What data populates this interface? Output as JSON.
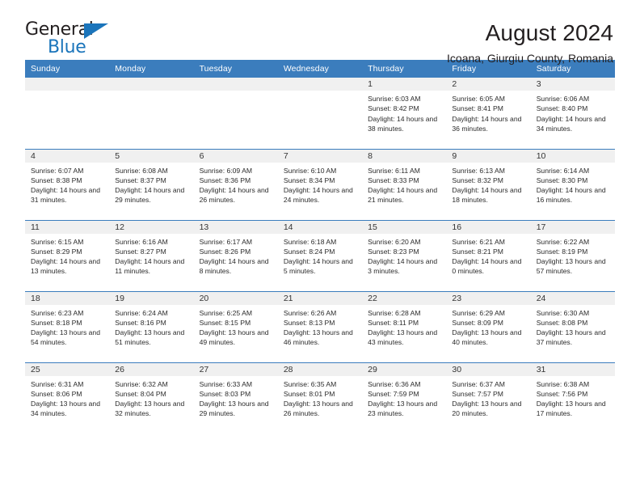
{
  "brand": {
    "word_one": "General",
    "word_two": "Blue",
    "accent_color": "#1b75bb",
    "triangle_icon": "brand-triangle-icon"
  },
  "header": {
    "title": "August 2024",
    "location": "Icoana, Giurgiu County, Romania"
  },
  "calendar": {
    "header_background": "#3b7dbd",
    "daynum_background": "#f0f0f0",
    "weekdays": [
      "Sunday",
      "Monday",
      "Tuesday",
      "Wednesday",
      "Thursday",
      "Friday",
      "Saturday"
    ],
    "labels": {
      "sunrise": "Sunrise:",
      "sunset": "Sunset:",
      "daylight": "Daylight:"
    },
    "weeks": [
      [
        {
          "day": "",
          "sunrise": "",
          "sunset": "",
          "daylight": ""
        },
        {
          "day": "",
          "sunrise": "",
          "sunset": "",
          "daylight": ""
        },
        {
          "day": "",
          "sunrise": "",
          "sunset": "",
          "daylight": ""
        },
        {
          "day": "",
          "sunrise": "",
          "sunset": "",
          "daylight": ""
        },
        {
          "day": "1",
          "sunrise": "Sunrise: 6:03 AM",
          "sunset": "Sunset: 8:42 PM",
          "daylight": "Daylight: 14 hours and 38 minutes."
        },
        {
          "day": "2",
          "sunrise": "Sunrise: 6:05 AM",
          "sunset": "Sunset: 8:41 PM",
          "daylight": "Daylight: 14 hours and 36 minutes."
        },
        {
          "day": "3",
          "sunrise": "Sunrise: 6:06 AM",
          "sunset": "Sunset: 8:40 PM",
          "daylight": "Daylight: 14 hours and 34 minutes."
        }
      ],
      [
        {
          "day": "4",
          "sunrise": "Sunrise: 6:07 AM",
          "sunset": "Sunset: 8:38 PM",
          "daylight": "Daylight: 14 hours and 31 minutes."
        },
        {
          "day": "5",
          "sunrise": "Sunrise: 6:08 AM",
          "sunset": "Sunset: 8:37 PM",
          "daylight": "Daylight: 14 hours and 29 minutes."
        },
        {
          "day": "6",
          "sunrise": "Sunrise: 6:09 AM",
          "sunset": "Sunset: 8:36 PM",
          "daylight": "Daylight: 14 hours and 26 minutes."
        },
        {
          "day": "7",
          "sunrise": "Sunrise: 6:10 AM",
          "sunset": "Sunset: 8:34 PM",
          "daylight": "Daylight: 14 hours and 24 minutes."
        },
        {
          "day": "8",
          "sunrise": "Sunrise: 6:11 AM",
          "sunset": "Sunset: 8:33 PM",
          "daylight": "Daylight: 14 hours and 21 minutes."
        },
        {
          "day": "9",
          "sunrise": "Sunrise: 6:13 AM",
          "sunset": "Sunset: 8:32 PM",
          "daylight": "Daylight: 14 hours and 18 minutes."
        },
        {
          "day": "10",
          "sunrise": "Sunrise: 6:14 AM",
          "sunset": "Sunset: 8:30 PM",
          "daylight": "Daylight: 14 hours and 16 minutes."
        }
      ],
      [
        {
          "day": "11",
          "sunrise": "Sunrise: 6:15 AM",
          "sunset": "Sunset: 8:29 PM",
          "daylight": "Daylight: 14 hours and 13 minutes."
        },
        {
          "day": "12",
          "sunrise": "Sunrise: 6:16 AM",
          "sunset": "Sunset: 8:27 PM",
          "daylight": "Daylight: 14 hours and 11 minutes."
        },
        {
          "day": "13",
          "sunrise": "Sunrise: 6:17 AM",
          "sunset": "Sunset: 8:26 PM",
          "daylight": "Daylight: 14 hours and 8 minutes."
        },
        {
          "day": "14",
          "sunrise": "Sunrise: 6:18 AM",
          "sunset": "Sunset: 8:24 PM",
          "daylight": "Daylight: 14 hours and 5 minutes."
        },
        {
          "day": "15",
          "sunrise": "Sunrise: 6:20 AM",
          "sunset": "Sunset: 8:23 PM",
          "daylight": "Daylight: 14 hours and 3 minutes."
        },
        {
          "day": "16",
          "sunrise": "Sunrise: 6:21 AM",
          "sunset": "Sunset: 8:21 PM",
          "daylight": "Daylight: 14 hours and 0 minutes."
        },
        {
          "day": "17",
          "sunrise": "Sunrise: 6:22 AM",
          "sunset": "Sunset: 8:19 PM",
          "daylight": "Daylight: 13 hours and 57 minutes."
        }
      ],
      [
        {
          "day": "18",
          "sunrise": "Sunrise: 6:23 AM",
          "sunset": "Sunset: 8:18 PM",
          "daylight": "Daylight: 13 hours and 54 minutes."
        },
        {
          "day": "19",
          "sunrise": "Sunrise: 6:24 AM",
          "sunset": "Sunset: 8:16 PM",
          "daylight": "Daylight: 13 hours and 51 minutes."
        },
        {
          "day": "20",
          "sunrise": "Sunrise: 6:25 AM",
          "sunset": "Sunset: 8:15 PM",
          "daylight": "Daylight: 13 hours and 49 minutes."
        },
        {
          "day": "21",
          "sunrise": "Sunrise: 6:26 AM",
          "sunset": "Sunset: 8:13 PM",
          "daylight": "Daylight: 13 hours and 46 minutes."
        },
        {
          "day": "22",
          "sunrise": "Sunrise: 6:28 AM",
          "sunset": "Sunset: 8:11 PM",
          "daylight": "Daylight: 13 hours and 43 minutes."
        },
        {
          "day": "23",
          "sunrise": "Sunrise: 6:29 AM",
          "sunset": "Sunset: 8:09 PM",
          "daylight": "Daylight: 13 hours and 40 minutes."
        },
        {
          "day": "24",
          "sunrise": "Sunrise: 6:30 AM",
          "sunset": "Sunset: 8:08 PM",
          "daylight": "Daylight: 13 hours and 37 minutes."
        }
      ],
      [
        {
          "day": "25",
          "sunrise": "Sunrise: 6:31 AM",
          "sunset": "Sunset: 8:06 PM",
          "daylight": "Daylight: 13 hours and 34 minutes."
        },
        {
          "day": "26",
          "sunrise": "Sunrise: 6:32 AM",
          "sunset": "Sunset: 8:04 PM",
          "daylight": "Daylight: 13 hours and 32 minutes."
        },
        {
          "day": "27",
          "sunrise": "Sunrise: 6:33 AM",
          "sunset": "Sunset: 8:03 PM",
          "daylight": "Daylight: 13 hours and 29 minutes."
        },
        {
          "day": "28",
          "sunrise": "Sunrise: 6:35 AM",
          "sunset": "Sunset: 8:01 PM",
          "daylight": "Daylight: 13 hours and 26 minutes."
        },
        {
          "day": "29",
          "sunrise": "Sunrise: 6:36 AM",
          "sunset": "Sunset: 7:59 PM",
          "daylight": "Daylight: 13 hours and 23 minutes."
        },
        {
          "day": "30",
          "sunrise": "Sunrise: 6:37 AM",
          "sunset": "Sunset: 7:57 PM",
          "daylight": "Daylight: 13 hours and 20 minutes."
        },
        {
          "day": "31",
          "sunrise": "Sunrise: 6:38 AM",
          "sunset": "Sunset: 7:56 PM",
          "daylight": "Daylight: 13 hours and 17 minutes."
        }
      ]
    ]
  }
}
